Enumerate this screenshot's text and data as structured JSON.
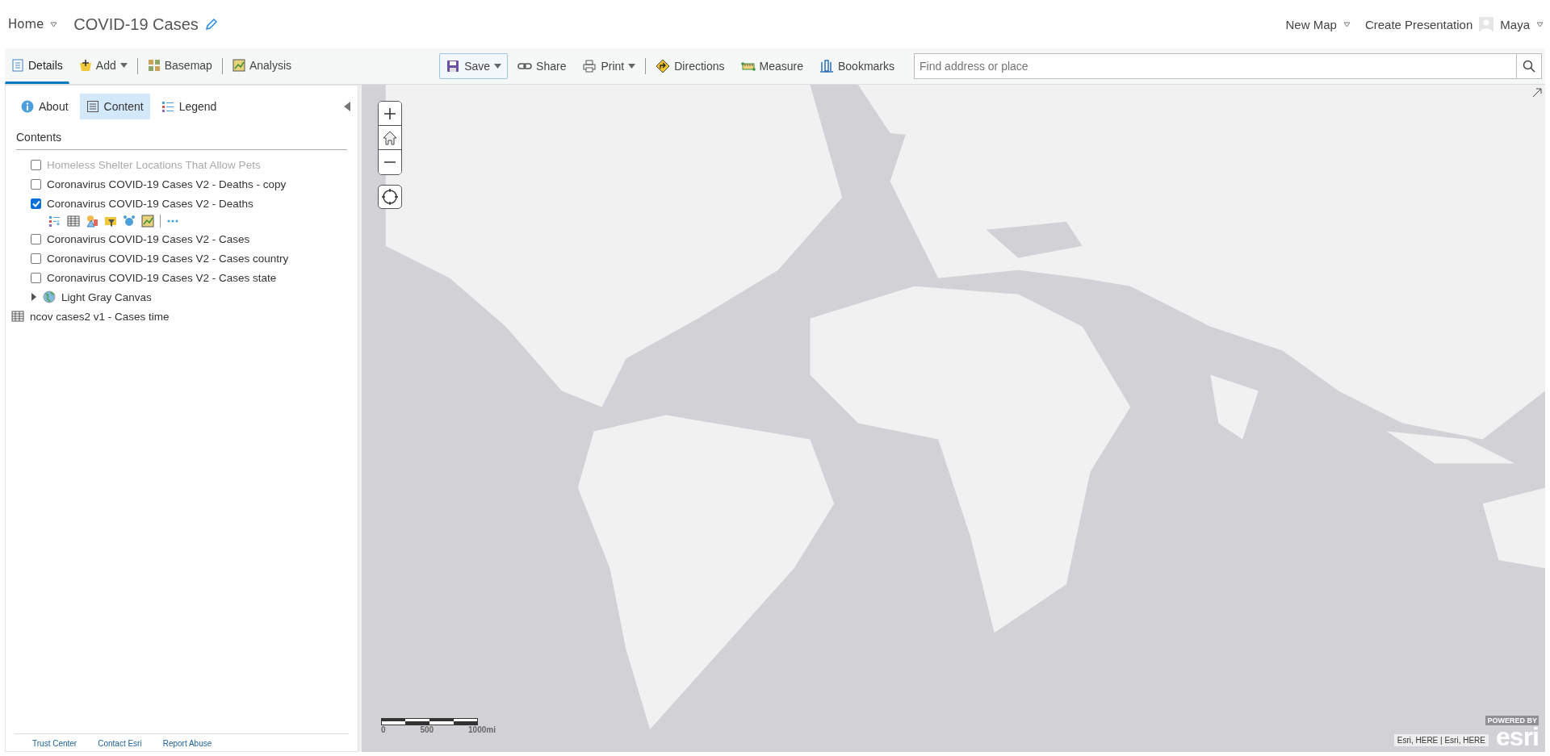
{
  "header": {
    "home": "Home",
    "title": "COVID-19 Cases",
    "new_map": "New Map",
    "create_presentation": "Create Presentation",
    "user": "Maya"
  },
  "toolbar": {
    "left": [
      {
        "label": "Details",
        "dropdown": false,
        "selected": true
      },
      {
        "label": "Add",
        "dropdown": true,
        "selected": false
      },
      {
        "label": "Basemap",
        "dropdown": false,
        "selected": false
      },
      {
        "label": "Analysis",
        "dropdown": false,
        "selected": false
      }
    ],
    "right": [
      {
        "label": "Save",
        "dropdown": true,
        "selected": true
      },
      {
        "label": "Share",
        "dropdown": false,
        "selected": false
      },
      {
        "label": "Print",
        "dropdown": true,
        "selected": false
      },
      {
        "label": "Directions",
        "dropdown": false,
        "selected": false
      },
      {
        "label": "Measure",
        "dropdown": false,
        "selected": false
      },
      {
        "label": "Bookmarks",
        "dropdown": false,
        "selected": false
      }
    ],
    "search": {
      "placeholder": "Find address or place"
    }
  },
  "panel": {
    "tabs": [
      {
        "label": "About",
        "selected": false
      },
      {
        "label": "Content",
        "selected": true
      },
      {
        "label": "Legend",
        "selected": false
      }
    ],
    "heading": "Contents",
    "layers": [
      {
        "kind": "layer",
        "name": "Homeless Shelter Locations That Allow Pets",
        "checked": false,
        "disabled": true,
        "selected": false
      },
      {
        "kind": "layer",
        "name": "Coronavirus COVID-19 Cases V2 - Deaths - copy",
        "checked": false,
        "disabled": false,
        "selected": false
      },
      {
        "kind": "layer",
        "name": "Coronavirus COVID-19 Cases V2 - Deaths",
        "checked": true,
        "disabled": false,
        "selected": true
      },
      {
        "kind": "layer",
        "name": "Coronavirus COVID-19 Cases V2 - Cases",
        "checked": false,
        "disabled": false,
        "selected": false
      },
      {
        "kind": "layer",
        "name": "Coronavirus COVID-19 Cases V2 - Cases country",
        "checked": false,
        "disabled": false,
        "selected": false
      },
      {
        "kind": "layer",
        "name": "Coronavirus COVID-19 Cases V2 - Cases state",
        "checked": false,
        "disabled": false,
        "selected": false
      },
      {
        "kind": "basemap",
        "name": "Light Gray Canvas",
        "expanded": false
      },
      {
        "kind": "table",
        "name": "ncov cases2 v1 - Cases time"
      }
    ],
    "footer_links": [
      "Trust Center",
      "Contact Esri",
      "Report Abuse"
    ]
  },
  "map": {
    "scale_labels": [
      "0",
      "500",
      "1000mi"
    ],
    "attribution": "Esri, HERE | Esri, HERE",
    "powered_by": "POWERED BY",
    "logo": "esri"
  }
}
